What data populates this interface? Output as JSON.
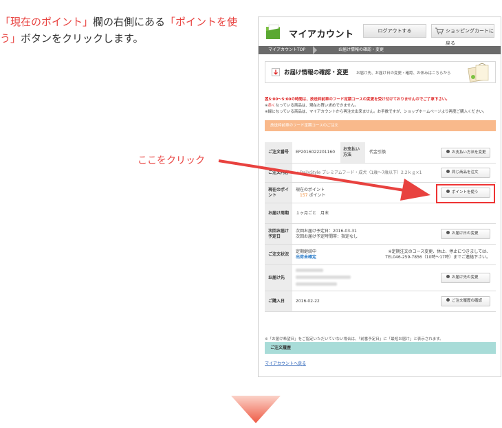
{
  "instruction": {
    "part1": "「現在のポイント」",
    "part2": "欄の右側にある",
    "part3": "「ポイントを使う」",
    "part4": "ボタンをクリックします。"
  },
  "callout": "ここをクリック",
  "header": {
    "brand": "マイアカウント",
    "logout": "ログアウトする",
    "cart": "ショッピングカートに戻る"
  },
  "breadcrumb": {
    "home": "マイアカウントTOP",
    "current": "お届け情報の確認・変更"
  },
  "section": {
    "title": "お届け情報の確認・変更",
    "subtitle": "お届け先、お届け日の変更・確認、お休みはこちらから"
  },
  "notice": {
    "line0": "翌5:00～5:00の時間は、放送枠前車のフード定期コースの変更を受け付けておりませんのでご了承下さい。",
    "line1_red": "赤く",
    "line1_rest": "なっている商品は、現在お買い求めできません。",
    "line2": "※緑になっている商品は、マイアカウントから再注文出来ません。お手数ですが、ショップホームページより再度ご購入ください。"
  },
  "orange_bar": "放送枠前車のフード定期コースのご注文",
  "rows": {
    "order_no": {
      "label": "ご注文番号",
      "value": "EP2016022201160",
      "pay_label": "お支払い方法",
      "pay_value": "代金引換",
      "button": "お支払い方法を変更"
    },
    "content": {
      "label": "ご注文内容",
      "value": "・DailyStyle プレミアムフード・成犬（1歳～7歳以下）2.2ｋｇ×1",
      "button": "同じ商品を注文"
    },
    "points": {
      "label": "現在のポイント",
      "value_label": "現在のポイント",
      "value_num": "157",
      "value_unit": "ポイント",
      "button": "ポイントを使う"
    },
    "cycle": {
      "label": "お届け周期",
      "value": "１ヶ月ごと　月末"
    },
    "next": {
      "label": "次回お届け予定日",
      "line1": "次回お届け予定日：2016-03-31",
      "line2": "次回お届け予定時間帯：指定なし",
      "button": "お届け日の変更"
    },
    "status": {
      "label": "ご注文状況",
      "line1": "定期継続中",
      "line2": "出荷未確定",
      "note": "※定期注文のコース変更、休止、停止につきましては、TEL046-259-7856（10時～17時）までご連絡下さい。"
    },
    "address": {
      "label": "お届け先",
      "button": "お届け先の変更"
    },
    "purchase": {
      "label": "ご購入日",
      "value": "2016-02-22",
      "button": "ご注文履歴の確認"
    }
  },
  "bottom_note": "※「お届け希望日」をご指定いただいていない場合は、「前番予定日」に「最短お届け」と表示されます。",
  "history_bar": "ご注文履歴",
  "back_link": "マイアカウントへ戻る"
}
